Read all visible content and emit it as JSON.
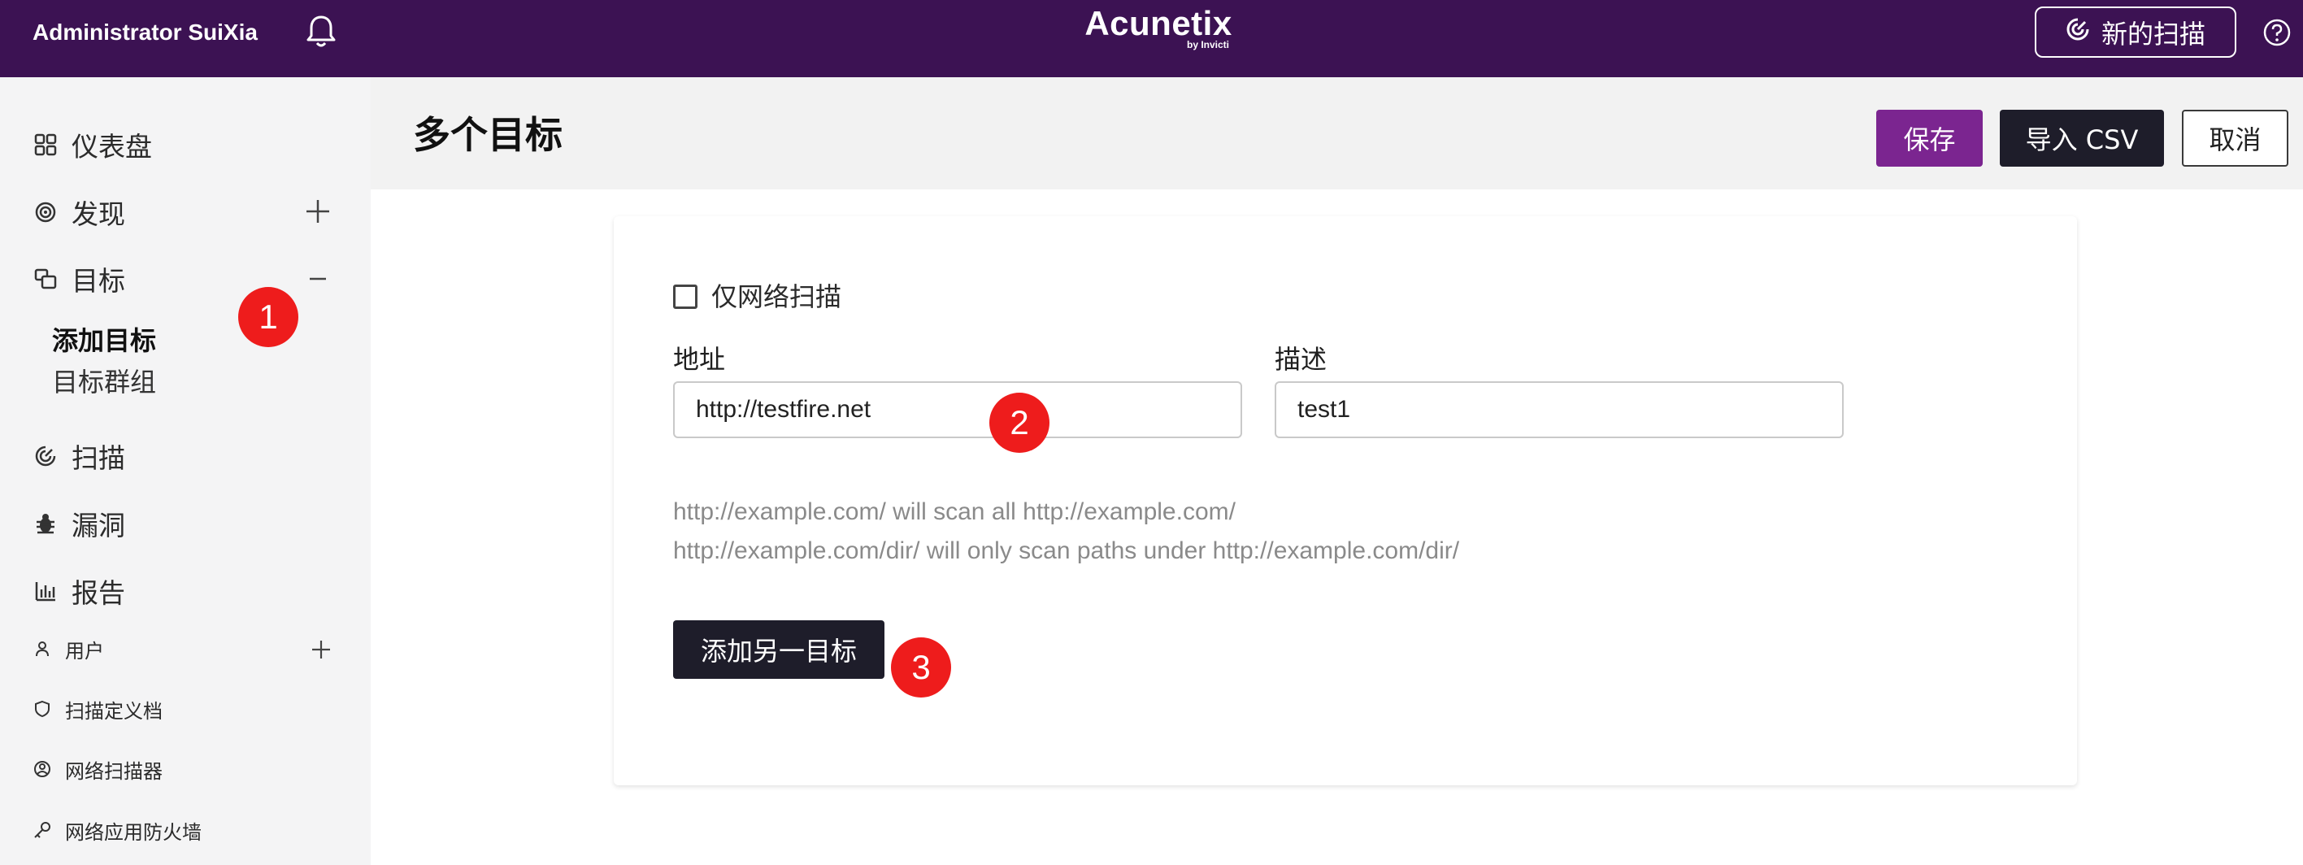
{
  "topbar": {
    "user": "Administrator SuiXia",
    "brand": "Acunetix",
    "brand_sub": "by Invicti",
    "new_scan": "新的扫描",
    "bg_color": "#3c1253"
  },
  "sidebar": {
    "dashboard": "仪表盘",
    "discovery": "发现",
    "targets": "目标",
    "add_target": "添加目标",
    "target_groups": "目标群组",
    "scans": "扫描",
    "vulns": "漏洞",
    "reports": "报告",
    "users": "用户",
    "scan_profiles": "扫描定义档",
    "network_scanner": "网络扫描器",
    "waf": "网络应用防火墙"
  },
  "page": {
    "title": "多个目标",
    "save": "保存",
    "import_csv": "导入 CSV",
    "cancel": "取消"
  },
  "form": {
    "network_only_label": "仅网络扫描",
    "network_only_checked": false,
    "address_label": "地址",
    "address_value": "http://testfire.net",
    "desc_label": "描述",
    "desc_value": "test1",
    "hint1": "http://example.com/ will scan all http://example.com/",
    "hint2": "http://example.com/dir/ will only scan paths under http://example.com/dir/",
    "add_another": "添加另一目标"
  },
  "markers": [
    "1",
    "2",
    "3"
  ],
  "colors": {
    "accent": "#7b2590",
    "dark_button": "#1e1d2a",
    "marker": "#ee1c1c"
  }
}
